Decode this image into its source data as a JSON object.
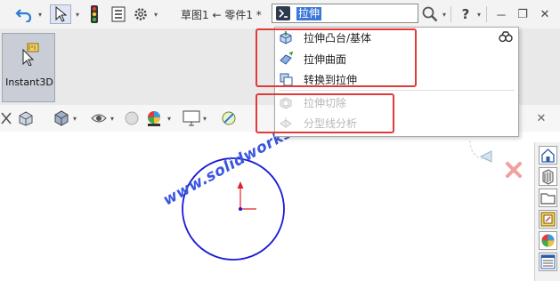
{
  "header": {
    "doc_title": "草图1 ← 零件1 *",
    "search_value": "拉伸",
    "help_label": "?",
    "window_min": "－",
    "window_restore": "❐",
    "window_close": "✕"
  },
  "ribbon": {
    "instant3d_label": "Instant3D"
  },
  "dropdown": {
    "items": [
      {
        "label": "拉伸凸台/基体",
        "enabled": true
      },
      {
        "label": "拉伸曲面",
        "enabled": true
      },
      {
        "label": "转换到拉伸",
        "enabled": true
      },
      {
        "label": "拉伸切除",
        "enabled": false
      },
      {
        "label": "分型线分析",
        "enabled": false
      }
    ]
  },
  "watermark": {
    "text": "www.solidworkszxw.com"
  },
  "colors": {
    "highlight_box": "#e23a3a",
    "sketch_circle": "#1a1ad6",
    "axis_red": "#e0202a",
    "watermark": "#3a56e0",
    "search_selection": "#3b78d8"
  }
}
